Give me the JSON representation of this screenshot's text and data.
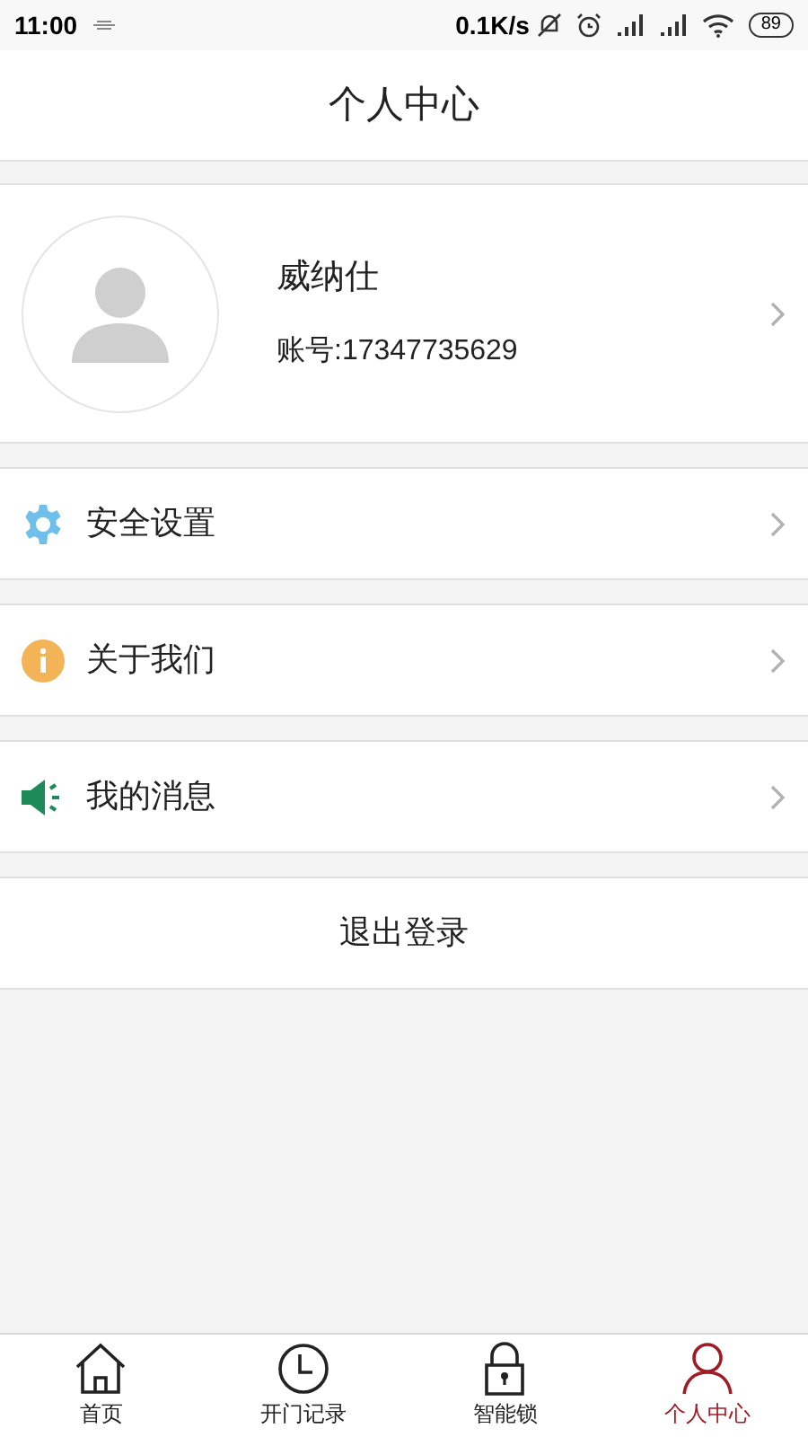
{
  "status_bar": {
    "time": "11:00",
    "speed": "0.1K/s",
    "battery": "89"
  },
  "header": {
    "title": "个人中心"
  },
  "profile": {
    "name": "威纳仕",
    "account": "账号:17347735629"
  },
  "menu": [
    {
      "kind": "gear",
      "label": "安全设置"
    },
    {
      "kind": "info",
      "label": "关于我们"
    },
    {
      "kind": "speaker",
      "label": "我的消息"
    }
  ],
  "logout": "退出登录",
  "tabs": [
    {
      "kind": "home",
      "label": "首页",
      "selected": false
    },
    {
      "kind": "clock",
      "label": "开门记录",
      "selected": false
    },
    {
      "kind": "lock",
      "label": "智能锁",
      "selected": false
    },
    {
      "kind": "person",
      "label": "个人中心",
      "selected": true
    }
  ]
}
